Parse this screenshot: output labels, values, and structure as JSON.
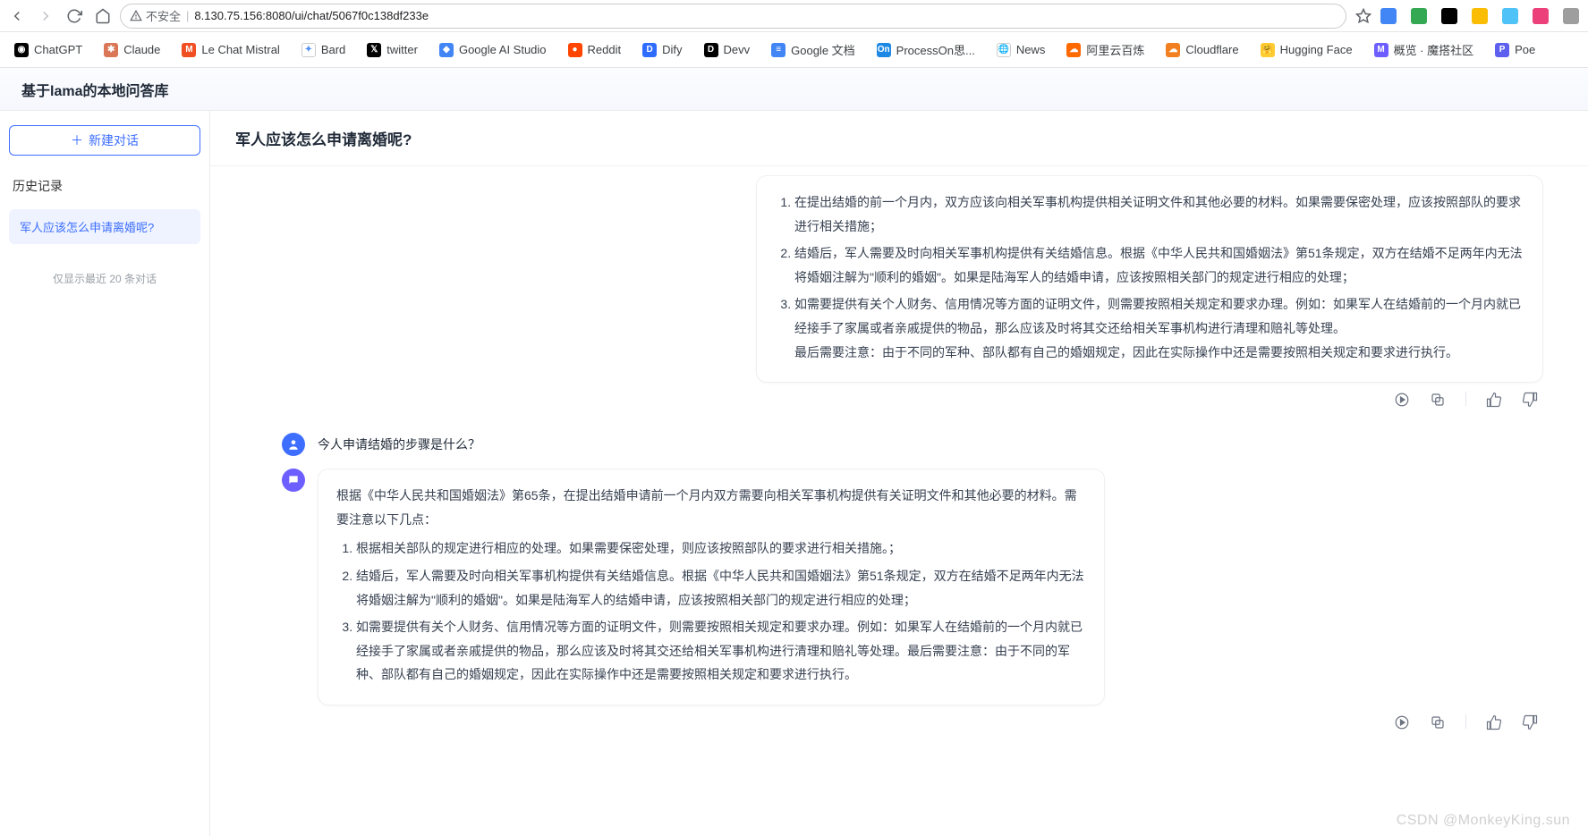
{
  "browser": {
    "insecure_label": "不安全",
    "url": "8.130.75.156:8080/ui/chat/5067f0c138df233e"
  },
  "bookmarks": [
    {
      "label": "ChatGPT",
      "color": "#000"
    },
    {
      "label": "Claude",
      "color": "#d97757"
    },
    {
      "label": "Le Chat Mistral",
      "color": "#f04e23"
    },
    {
      "label": "Bard",
      "color": "#4f8ef7"
    },
    {
      "label": "twitter",
      "color": "#000"
    },
    {
      "label": "Google AI Studio",
      "color": "#4285f4"
    },
    {
      "label": "Reddit",
      "color": "#ff4500"
    },
    {
      "label": "Dify",
      "color": "#2e6cff"
    },
    {
      "label": "Devv",
      "color": "#000"
    },
    {
      "label": "Google 文档",
      "color": "#4285f4"
    },
    {
      "label": "ProcessOn思...",
      "color": "#1e88e5"
    },
    {
      "label": "News",
      "color": "#5f6368"
    },
    {
      "label": "阿里云百炼",
      "color": "#ff6a00"
    },
    {
      "label": "Cloudflare",
      "color": "#f38020"
    },
    {
      "label": "Hugging Face",
      "color": "#ffcc33"
    },
    {
      "label": "概览 · 魔搭社区",
      "color": "#6d5fff"
    },
    {
      "label": "Poe",
      "color": "#5d5fef"
    }
  ],
  "app": {
    "title": "基于lama的本地问答库"
  },
  "sidebar": {
    "new_chat_label": "新建对话",
    "history_label": "历史记录",
    "items": [
      {
        "title": "军人应该怎么申请离婚呢?"
      }
    ],
    "footer_label": "仅显示最近 20 条对话"
  },
  "chat": {
    "title": "军人应该怎么申请离婚呢?",
    "assistant1": {
      "li1": "在提出结婚的前一个月内，双方应该向相关军事机构提供相关证明文件和其他必要的材料。如果需要保密处理，应该按照部队的要求进行相关措施；",
      "li2": "结婚后，军人需要及时向相关军事机构提供有关结婚信息。根据《中华人民共和国婚姻法》第51条规定，双方在结婚不足两年内无法将婚姻注解为\"顺利的婚姻\"。如果是陆海军人的结婚申请，应该按照相关部门的规定进行相应的处理；",
      "li3": "如需要提供有关个人财务、信用情况等方面的证明文件，则需要按照相关规定和要求办理。例如：如果军人在结婚前的一个月内就已经接手了家属或者亲戚提供的物品，那么应该及时将其交还给相关军事机构进行清理和赔礼等处理。",
      "trail": "最后需要注意：由于不同的军种、部队都有自己的婚姻规定，因此在实际操作中还是需要按照相关规定和要求进行执行。"
    },
    "user2": {
      "text": "今人申请结婚的步骤是什么？"
    },
    "assistant2": {
      "lead": "根据《中华人民共和国婚姻法》第65条，在提出结婚申请前一个月内双方需要向相关军事机构提供有关证明文件和其他必要的材料。需要注意以下几点：",
      "li1": "根据相关部队的规定进行相应的处理。如果需要保密处理，则应该按照部队的要求进行相关措施。；",
      "li2": "结婚后，军人需要及时向相关军事机构提供有关结婚信息。根据《中华人民共和国婚姻法》第51条规定，双方在结婚不足两年内无法将婚姻注解为\"顺利的婚姻\"。如果是陆海军人的结婚申请，应该按照相关部门的规定进行相应的处理；",
      "li3": "如需要提供有关个人财务、信用情况等方面的证明文件，则需要按照相关规定和要求办理。例如：如果军人在结婚前的一个月内就已经接手了家属或者亲戚提供的物品，那么应该及时将其交还给相关军事机构进行清理和赔礼等处理。最后需要注意：由于不同的军种、部队都有自己的婚姻规定，因此在实际操作中还是需要按照相关规定和要求进行执行。"
    }
  },
  "watermark": "CSDN @MonkeyKing.sun"
}
